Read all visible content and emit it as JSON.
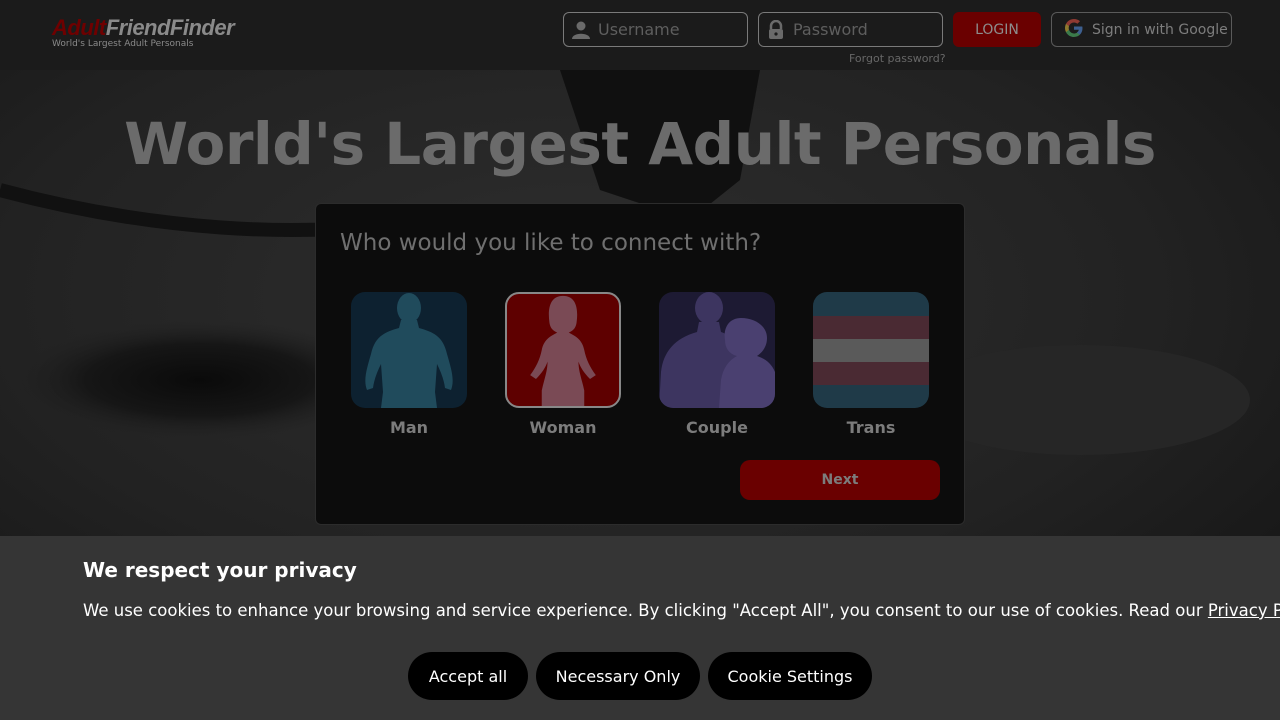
{
  "header": {
    "logo_part1": "Adult",
    "logo_part2": "FriendFinder",
    "logo_tagline": "World's Largest Adult Personals",
    "username_placeholder": "Username",
    "password_placeholder": "Password",
    "login_label": "LOGIN",
    "google_label": "Sign in with Google",
    "forgot_label": "Forgot password?"
  },
  "hero": {
    "title": "World's Largest Adult Personals"
  },
  "connect": {
    "question": "Who would you like to connect with?",
    "options": [
      {
        "label": "Man",
        "icon": "man-silhouette-icon",
        "color": "#0d2130",
        "selected": false
      },
      {
        "label": "Woman",
        "icon": "woman-silhouette-icon",
        "color": "#5e0000",
        "selected": true
      },
      {
        "label": "Couple",
        "icon": "couple-silhouette-icon",
        "color": "#1d1a33",
        "selected": false
      },
      {
        "label": "Trans",
        "icon": "trans-flag-icon",
        "color": "#1f3a48",
        "selected": false
      }
    ],
    "next_label": "Next"
  },
  "cookie": {
    "title": "We respect your privacy",
    "text": "We use cookies to enhance your browsing and service experience. By clicking \"Accept All\", you consent to our use of cookies. Read our ",
    "policy_link": "Privacy Policy",
    "accept_label": "Accept all",
    "necessary_label": "Necessary Only",
    "settings_label": "Cookie Settings"
  },
  "colors": {
    "accent": "#6a0000",
    "cookie_bg": "#353535"
  }
}
